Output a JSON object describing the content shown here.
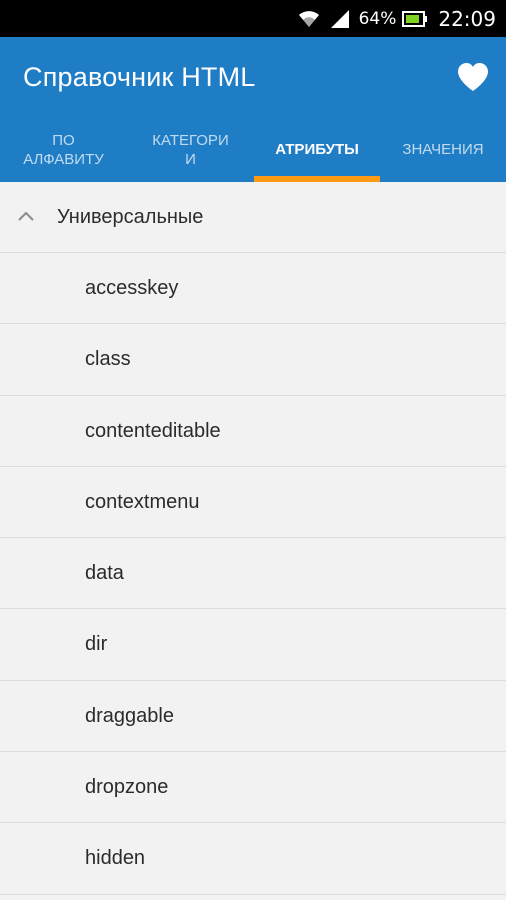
{
  "status_bar": {
    "battery_percent": "64%",
    "time": "22:09",
    "icons": [
      "wifi-icon",
      "signal-icon",
      "battery-charging-icon"
    ]
  },
  "app_bar": {
    "title": "Справочник HTML",
    "favorite_icon": "heart-icon",
    "color": "#1f7dc6"
  },
  "tabs": [
    {
      "label": "ПО АЛФАВИТУ",
      "line1": "ПО",
      "line2": "АЛФАВИТУ",
      "active": false
    },
    {
      "label": "КАТЕГОРИИ",
      "line1": "КАТЕГОРИ",
      "line2": "И",
      "active": false
    },
    {
      "label": "АТРИБУТЫ",
      "active": true
    },
    {
      "label": "ЗНАЧЕНИЯ",
      "active": false
    }
  ],
  "accent_color": "#ff9a12",
  "list": {
    "group": {
      "label": "Универсальные",
      "icon": "chevron-up-icon",
      "expanded": true
    },
    "items": [
      "accesskey",
      "class",
      "contenteditable",
      "contextmenu",
      "data",
      "dir",
      "draggable",
      "dropzone",
      "hidden"
    ]
  }
}
